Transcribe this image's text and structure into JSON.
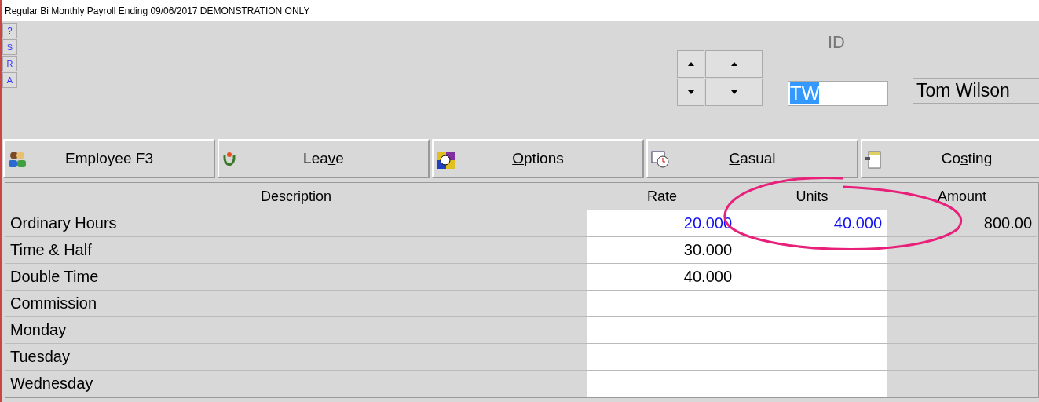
{
  "window": {
    "title": "Regular Bi Monthly Payroll Ending 09/06/2017 DEMONSTRATION ONLY"
  },
  "side_buttons": [
    "?",
    "S",
    "R",
    "A"
  ],
  "id_label": "ID",
  "id_field": {
    "value": "TW",
    "selected": true
  },
  "name_field": {
    "value": "Tom Wilson"
  },
  "nav_buttons": [
    {
      "kind": "up",
      "selected": false
    },
    {
      "kind": "up",
      "selected": false
    },
    {
      "kind": "down",
      "selected": false
    },
    {
      "kind": "down",
      "selected": false
    }
  ],
  "tabs": [
    {
      "label": {
        "before": "Employee F3"
      }
    },
    {
      "label": {
        "before": "Lea",
        "access_key": "v",
        "after": "e"
      }
    },
    {
      "label": {
        "access_key": "O",
        "after": "ptions"
      }
    },
    {
      "label": {
        "access_key": "C",
        "after": "asual"
      }
    },
    {
      "label": {
        "before": "Co",
        "access_key": "s",
        "after": "ting"
      }
    }
  ],
  "table": {
    "columns": [
      "Description",
      "Rate",
      "Units",
      "Amount"
    ],
    "rows": [
      {
        "description": "Ordinary Hours",
        "rate": "20.000",
        "units": "40.000",
        "amount": "800.00",
        "edited": true
      },
      {
        "description": "Time & Half",
        "rate": "30.000",
        "edited": false
      },
      {
        "description": "Double Time",
        "rate": "40.000",
        "edited": false
      },
      {
        "description": "Commission"
      },
      {
        "description": "Monday"
      },
      {
        "description": "Tuesday"
      },
      {
        "description": "Wednesday"
      }
    ]
  }
}
